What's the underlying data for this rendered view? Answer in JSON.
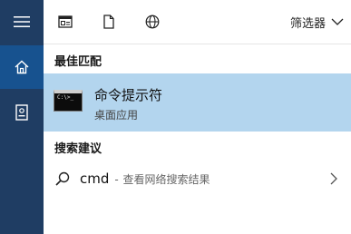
{
  "sidebar": {
    "items": [
      {
        "name": "menu",
        "icon": "hamburger-menu-icon"
      },
      {
        "name": "home",
        "icon": "home-icon"
      },
      {
        "name": "notebook",
        "icon": "notebook-icon"
      }
    ],
    "bg_color": "#1f3d63",
    "active_color": "#17528f"
  },
  "toolbar": {
    "icons": [
      "window-icon",
      "document-icon",
      "globe-icon"
    ],
    "filter_label": "筛选器"
  },
  "best_match": {
    "section_title": "最佳匹配",
    "app_name": "命令提示符",
    "app_type": "桌面应用",
    "icon": "command-prompt-icon",
    "icon_text": "C:\\>_",
    "highlight_color": "#b3d5ee"
  },
  "suggestions": {
    "section_title": "搜索建议",
    "items": [
      {
        "query": "cmd",
        "separator": "-",
        "hint": "查看网络搜索结果",
        "icon": "search-icon"
      }
    ]
  }
}
